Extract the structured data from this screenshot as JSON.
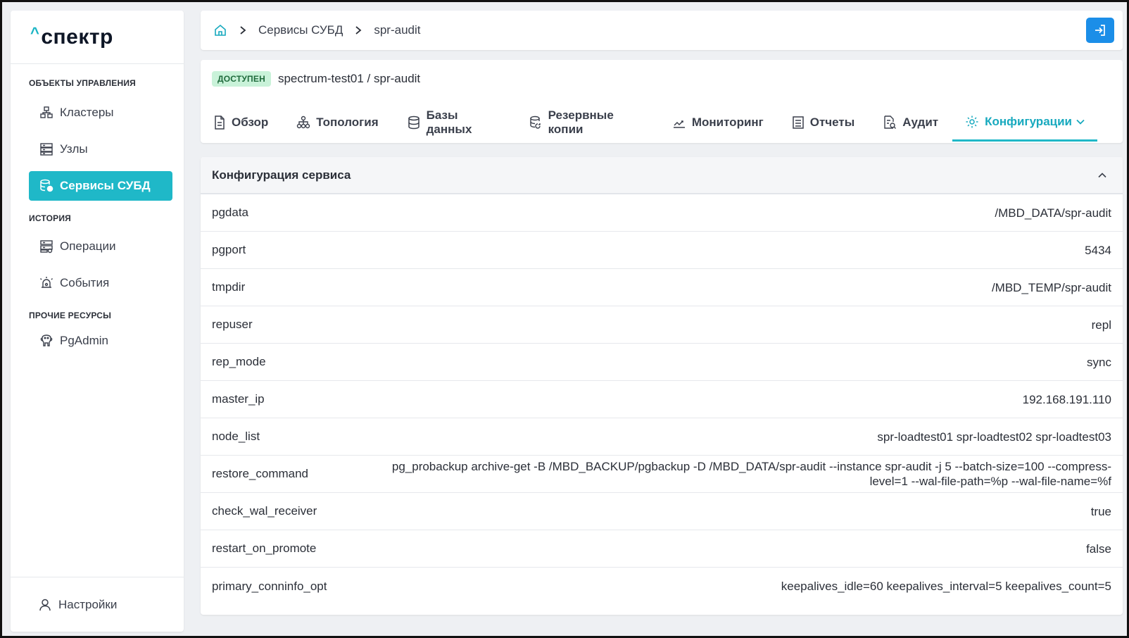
{
  "sidebar": {
    "logo": "спектр",
    "sections": [
      {
        "title": "ОБЪЕКТЫ УПРАВЛЕНИЯ",
        "items": [
          {
            "label": "Кластеры",
            "icon": "cluster-icon"
          },
          {
            "label": "Узлы",
            "icon": "server-icon"
          },
          {
            "label": "Сервисы СУБД",
            "icon": "database-service-icon",
            "active": true
          }
        ]
      },
      {
        "title": "ИСТОРИЯ",
        "items": [
          {
            "label": "Операции",
            "icon": "operations-icon"
          },
          {
            "label": "События",
            "icon": "alarm-icon"
          }
        ]
      },
      {
        "title": "ПРОЧИЕ РЕСУРСЫ",
        "items": [
          {
            "label": "PgAdmin",
            "icon": "elephant-icon"
          }
        ]
      }
    ],
    "settings_label": "Настройки"
  },
  "breadcrumb": {
    "items": [
      "Сервисы СУБД",
      "spr-audit"
    ]
  },
  "header": {
    "status": "ДОСТУПЕН",
    "service_path": "spectrum-test01 /  spr-audit",
    "tabs": [
      {
        "label": "Обзор",
        "icon": "document-icon"
      },
      {
        "label": "Топология",
        "icon": "topology-icon"
      },
      {
        "label": "Базы данных",
        "icon": "database-icon"
      },
      {
        "label": "Резервные копии",
        "icon": "backup-icon"
      },
      {
        "label": "Мониторинг",
        "icon": "chart-icon"
      },
      {
        "label": "Отчеты",
        "icon": "report-icon"
      },
      {
        "label": "Аудит",
        "icon": "audit-icon"
      },
      {
        "label": "Конфигурации",
        "icon": "gear-icon",
        "active": true
      }
    ]
  },
  "config": {
    "title": "Конфигурация сервиса",
    "rows": [
      {
        "key": "pgdata",
        "value": "/MBD_DATA/spr-audit"
      },
      {
        "key": "pgport",
        "value": "5434"
      },
      {
        "key": "tmpdir",
        "value": "/MBD_TEMP/spr-audit"
      },
      {
        "key": "repuser",
        "value": "repl"
      },
      {
        "key": "rep_mode",
        "value": "sync"
      },
      {
        "key": "master_ip",
        "value": "192.168.191.110"
      },
      {
        "key": "node_list",
        "value": "spr-loadtest01 spr-loadtest02 spr-loadtest03"
      },
      {
        "key": "restore_command",
        "value": "pg_probackup archive-get -B /MBD_BACKUP/pgbackup -D /MBD_DATA/spr-audit --instance spr-audit -j 5 --batch-size=100 --compress-level=1 --wal-file-path=%p --wal-file-name=%f"
      },
      {
        "key": "check_wal_receiver",
        "value": "true"
      },
      {
        "key": "restart_on_promote",
        "value": "false"
      },
      {
        "key": "primary_conninfo_opt",
        "value": "keepalives_idle=60 keepalives_interval=5 keepalives_count=5"
      }
    ]
  },
  "colors": {
    "accent": "#1fb8c8",
    "primary_button": "#1b8ee8",
    "badge_bg": "#c9f2d9"
  }
}
